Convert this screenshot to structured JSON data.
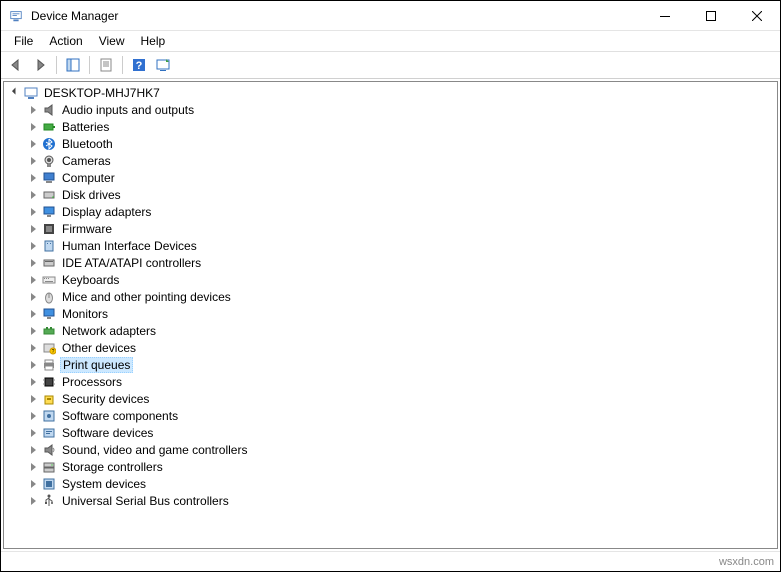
{
  "window": {
    "title": "Device Manager"
  },
  "menubar": {
    "file": "File",
    "action": "Action",
    "view": "View",
    "help": "Help"
  },
  "tree": {
    "root": "DESKTOP-MHJ7HK7",
    "nodes": {
      "audio": "Audio inputs and outputs",
      "batteries": "Batteries",
      "bluetooth": "Bluetooth",
      "cameras": "Cameras",
      "computer": "Computer",
      "disk": "Disk drives",
      "display": "Display adapters",
      "firmware": "Firmware",
      "hid": "Human Interface Devices",
      "ide": "IDE ATA/ATAPI controllers",
      "keyboards": "Keyboards",
      "mice": "Mice and other pointing devices",
      "monitors": "Monitors",
      "network": "Network adapters",
      "other": "Other devices",
      "print": "Print queues",
      "processors": "Processors",
      "security": "Security devices",
      "swcomp": "Software components",
      "swdev": "Software devices",
      "sound": "Sound, video and game controllers",
      "storage": "Storage controllers",
      "system": "System devices",
      "usb": "Universal Serial Bus controllers"
    }
  },
  "selected": "print",
  "statusbar": {
    "text": "wsxdn.com"
  }
}
